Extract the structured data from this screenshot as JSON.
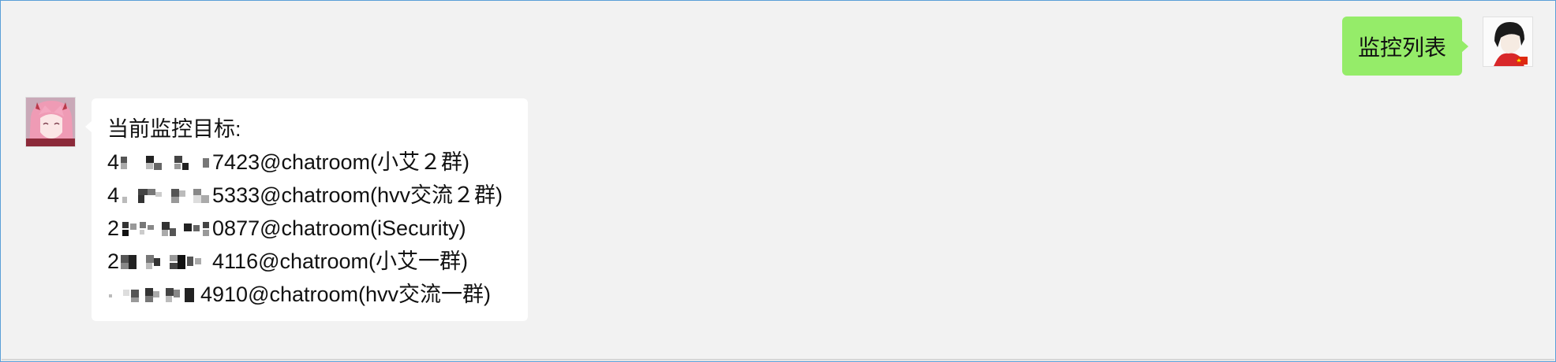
{
  "conversation": {
    "outgoing_message": {
      "text": "监控列表"
    },
    "incoming_message": {
      "heading": "当前监控目标:",
      "targets": [
        {
          "prefix": "4",
          "suffix": "7423@chatroom(小艾２群)"
        },
        {
          "prefix": "4",
          "suffix": "5333@chatroom(hvv交流２群)"
        },
        {
          "prefix": "2",
          "suffix": "0877@chatroom(iSecurity)"
        },
        {
          "prefix": "2",
          "suffix": "4116@chatroom(小艾一群)"
        },
        {
          "prefix": "",
          "suffix": "4910@chatroom(hvv交流一群)"
        }
      ]
    }
  },
  "colors": {
    "outgoing_bubble": "#95ec69",
    "incoming_bubble": "#ffffff",
    "background": "#f2f2f2",
    "frame_border": "#5a9fd8"
  },
  "icons": {
    "my_avatar": "avatar-anime-boy-icon",
    "bot_avatar": "avatar-anime-girl-icon",
    "redaction": "pixelated-mosaic-icon"
  }
}
